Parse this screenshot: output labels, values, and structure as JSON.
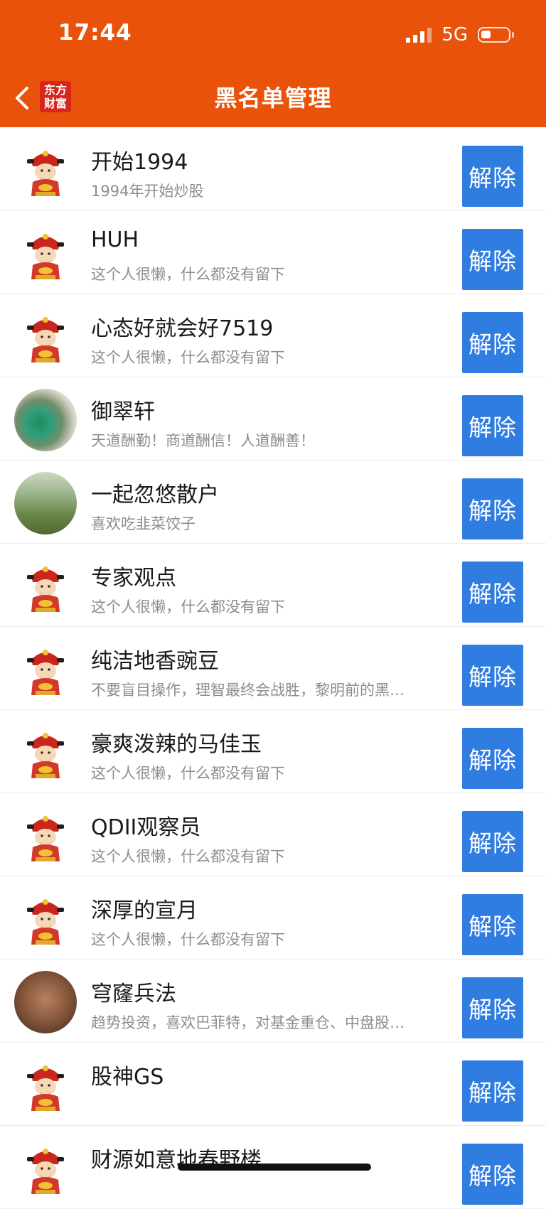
{
  "status": {
    "time": "17:44",
    "network": "5G"
  },
  "header": {
    "title": "黑名单管理",
    "brand": [
      "东方",
      "财富"
    ]
  },
  "list": [
    {
      "name": "开始1994",
      "sig": "1994年开始炒股",
      "avatar": "god",
      "btn": "解除"
    },
    {
      "name": "HUH",
      "sig": "这个人很懒，什么都没有留下",
      "avatar": "god",
      "btn": "解除"
    },
    {
      "name": "心态好就会好7519",
      "sig": "这个人很懒，什么都没有留下",
      "avatar": "god",
      "btn": "解除"
    },
    {
      "name": "御翠轩",
      "sig": "天道酬勤！商道酬信！人道酬善！",
      "avatar": "jade",
      "btn": "解除"
    },
    {
      "name": "一起忽悠散户",
      "sig": "喜欢吃韭菜饺子",
      "avatar": "girl",
      "btn": "解除"
    },
    {
      "name": "专家观点",
      "sig": "这个人很懒，什么都没有留下",
      "avatar": "god",
      "btn": "解除"
    },
    {
      "name": "纯洁地香豌豆",
      "sig": "不要盲目操作，理智最终会战胜，黎明前的黑…",
      "avatar": "god",
      "btn": "解除"
    },
    {
      "name": "豪爽泼辣的马佳玉",
      "sig": "这个人很懒，什么都没有留下",
      "avatar": "god",
      "btn": "解除"
    },
    {
      "name": "QDII观察员",
      "sig": "这个人很懒，什么都没有留下",
      "avatar": "god",
      "btn": "解除"
    },
    {
      "name": "深厚的宣月",
      "sig": "这个人很懒，什么都没有留下",
      "avatar": "god",
      "btn": "解除"
    },
    {
      "name": "穹窿兵法",
      "sig": "趋势投资，喜欢巴菲特，对基金重仓、中盘股…",
      "avatar": "buddha",
      "btn": "解除"
    },
    {
      "name": "股神GS",
      "sig": "",
      "avatar": "god",
      "btn": "解除"
    },
    {
      "name": "财源如意地春野楼",
      "sig": "",
      "avatar": "god",
      "btn": "解除"
    }
  ]
}
